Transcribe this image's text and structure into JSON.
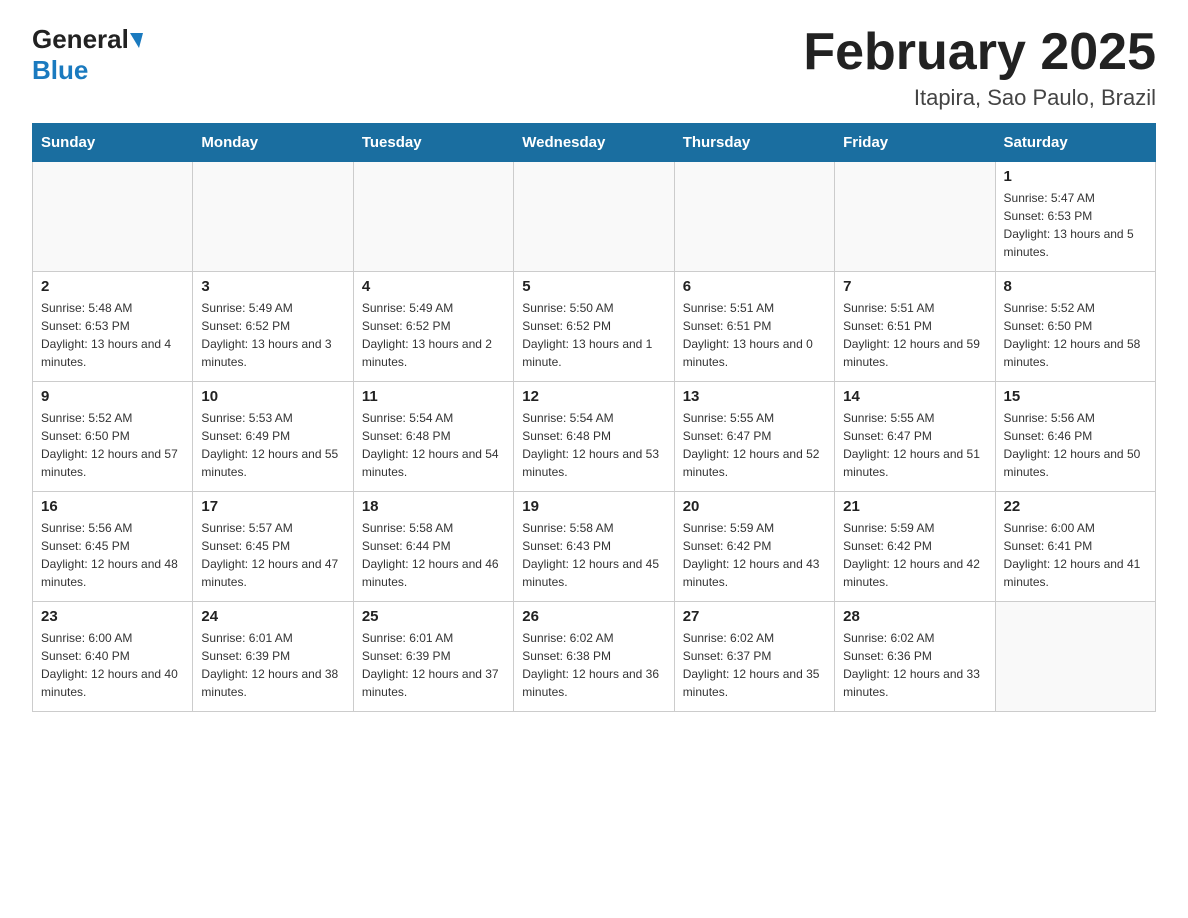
{
  "header": {
    "logo": {
      "general": "General",
      "blue": "Blue"
    },
    "title": "February 2025",
    "location": "Itapira, Sao Paulo, Brazil"
  },
  "weekdays": [
    "Sunday",
    "Monday",
    "Tuesday",
    "Wednesday",
    "Thursday",
    "Friday",
    "Saturday"
  ],
  "weeks": [
    [
      {
        "day": "",
        "info": ""
      },
      {
        "day": "",
        "info": ""
      },
      {
        "day": "",
        "info": ""
      },
      {
        "day": "",
        "info": ""
      },
      {
        "day": "",
        "info": ""
      },
      {
        "day": "",
        "info": ""
      },
      {
        "day": "1",
        "info": "Sunrise: 5:47 AM\nSunset: 6:53 PM\nDaylight: 13 hours and 5 minutes."
      }
    ],
    [
      {
        "day": "2",
        "info": "Sunrise: 5:48 AM\nSunset: 6:53 PM\nDaylight: 13 hours and 4 minutes."
      },
      {
        "day": "3",
        "info": "Sunrise: 5:49 AM\nSunset: 6:52 PM\nDaylight: 13 hours and 3 minutes."
      },
      {
        "day": "4",
        "info": "Sunrise: 5:49 AM\nSunset: 6:52 PM\nDaylight: 13 hours and 2 minutes."
      },
      {
        "day": "5",
        "info": "Sunrise: 5:50 AM\nSunset: 6:52 PM\nDaylight: 13 hours and 1 minute."
      },
      {
        "day": "6",
        "info": "Sunrise: 5:51 AM\nSunset: 6:51 PM\nDaylight: 13 hours and 0 minutes."
      },
      {
        "day": "7",
        "info": "Sunrise: 5:51 AM\nSunset: 6:51 PM\nDaylight: 12 hours and 59 minutes."
      },
      {
        "day": "8",
        "info": "Sunrise: 5:52 AM\nSunset: 6:50 PM\nDaylight: 12 hours and 58 minutes."
      }
    ],
    [
      {
        "day": "9",
        "info": "Sunrise: 5:52 AM\nSunset: 6:50 PM\nDaylight: 12 hours and 57 minutes."
      },
      {
        "day": "10",
        "info": "Sunrise: 5:53 AM\nSunset: 6:49 PM\nDaylight: 12 hours and 55 minutes."
      },
      {
        "day": "11",
        "info": "Sunrise: 5:54 AM\nSunset: 6:48 PM\nDaylight: 12 hours and 54 minutes."
      },
      {
        "day": "12",
        "info": "Sunrise: 5:54 AM\nSunset: 6:48 PM\nDaylight: 12 hours and 53 minutes."
      },
      {
        "day": "13",
        "info": "Sunrise: 5:55 AM\nSunset: 6:47 PM\nDaylight: 12 hours and 52 minutes."
      },
      {
        "day": "14",
        "info": "Sunrise: 5:55 AM\nSunset: 6:47 PM\nDaylight: 12 hours and 51 minutes."
      },
      {
        "day": "15",
        "info": "Sunrise: 5:56 AM\nSunset: 6:46 PM\nDaylight: 12 hours and 50 minutes."
      }
    ],
    [
      {
        "day": "16",
        "info": "Sunrise: 5:56 AM\nSunset: 6:45 PM\nDaylight: 12 hours and 48 minutes."
      },
      {
        "day": "17",
        "info": "Sunrise: 5:57 AM\nSunset: 6:45 PM\nDaylight: 12 hours and 47 minutes."
      },
      {
        "day": "18",
        "info": "Sunrise: 5:58 AM\nSunset: 6:44 PM\nDaylight: 12 hours and 46 minutes."
      },
      {
        "day": "19",
        "info": "Sunrise: 5:58 AM\nSunset: 6:43 PM\nDaylight: 12 hours and 45 minutes."
      },
      {
        "day": "20",
        "info": "Sunrise: 5:59 AM\nSunset: 6:42 PM\nDaylight: 12 hours and 43 minutes."
      },
      {
        "day": "21",
        "info": "Sunrise: 5:59 AM\nSunset: 6:42 PM\nDaylight: 12 hours and 42 minutes."
      },
      {
        "day": "22",
        "info": "Sunrise: 6:00 AM\nSunset: 6:41 PM\nDaylight: 12 hours and 41 minutes."
      }
    ],
    [
      {
        "day": "23",
        "info": "Sunrise: 6:00 AM\nSunset: 6:40 PM\nDaylight: 12 hours and 40 minutes."
      },
      {
        "day": "24",
        "info": "Sunrise: 6:01 AM\nSunset: 6:39 PM\nDaylight: 12 hours and 38 minutes."
      },
      {
        "day": "25",
        "info": "Sunrise: 6:01 AM\nSunset: 6:39 PM\nDaylight: 12 hours and 37 minutes."
      },
      {
        "day": "26",
        "info": "Sunrise: 6:02 AM\nSunset: 6:38 PM\nDaylight: 12 hours and 36 minutes."
      },
      {
        "day": "27",
        "info": "Sunrise: 6:02 AM\nSunset: 6:37 PM\nDaylight: 12 hours and 35 minutes."
      },
      {
        "day": "28",
        "info": "Sunrise: 6:02 AM\nSunset: 6:36 PM\nDaylight: 12 hours and 33 minutes."
      },
      {
        "day": "",
        "info": ""
      }
    ]
  ]
}
